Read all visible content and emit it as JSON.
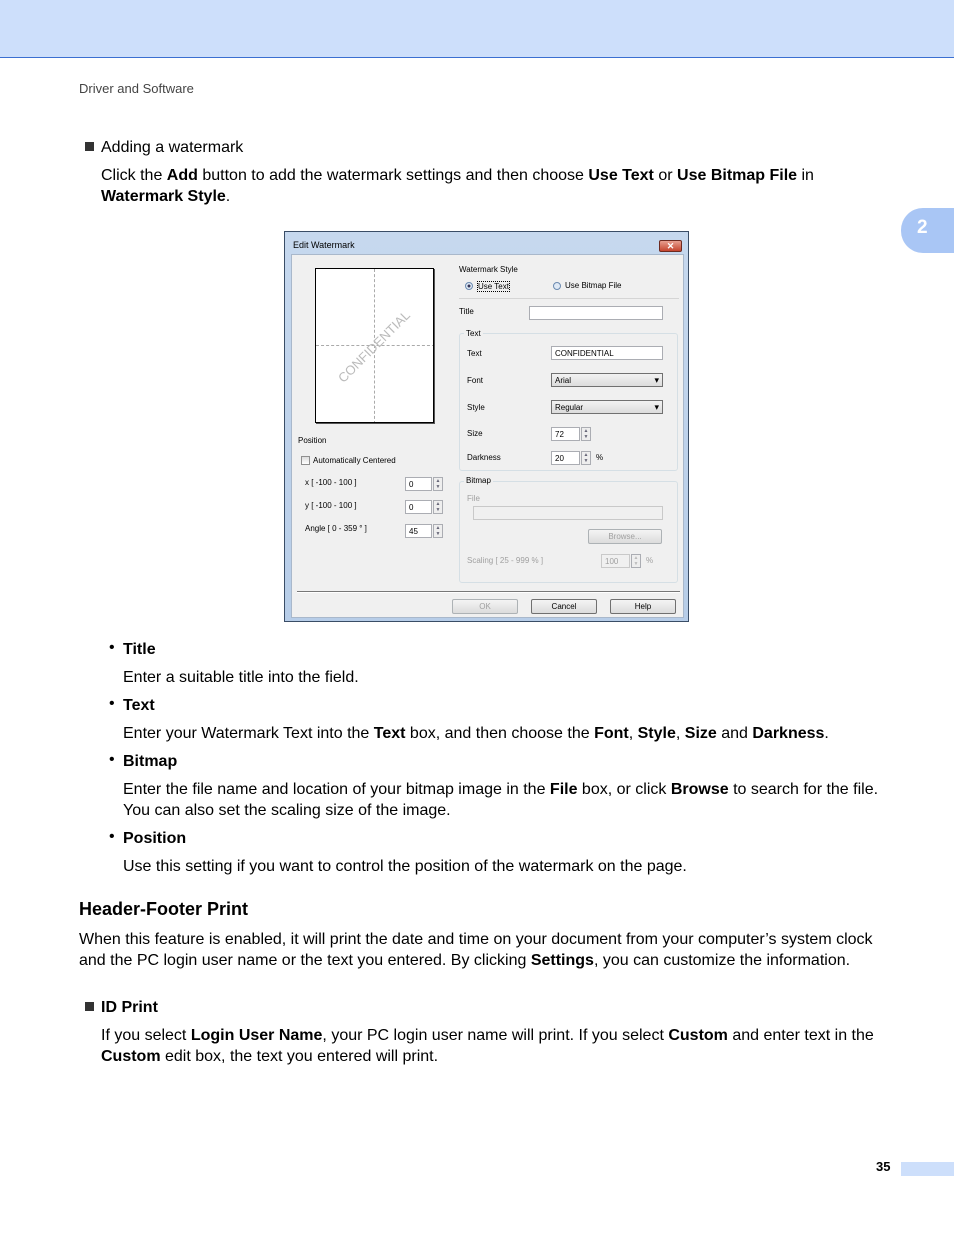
{
  "header": {
    "running_title": "Driver and Software",
    "chapter_tab": "2"
  },
  "intro": {
    "bullet": "Adding a watermark",
    "para": [
      {
        "t": "Click the "
      },
      {
        "b": "Add"
      },
      {
        "t": " button to add the watermark settings and then choose "
      },
      {
        "b": "Use Text"
      },
      {
        "t": " or "
      },
      {
        "b": "Use Bitmap File"
      },
      {
        "t": " in "
      },
      {
        "b": "Watermark Style"
      },
      {
        "t": "."
      }
    ]
  },
  "dialog": {
    "title": "Edit Watermark",
    "preview_text": "CONFIDENTIAL",
    "watermark_style": "Watermark Style",
    "use_text": "Use Text",
    "use_bitmap": "Use Bitmap File",
    "selected": "Use Text",
    "title_label": "Title",
    "title_value": "",
    "text_group": "Text",
    "text_label": "Text",
    "text_value": "CONFIDENTIAL",
    "font_label": "Font",
    "font_value": "Arial",
    "style_label": "Style",
    "style_value": "Regular",
    "size_label": "Size",
    "size_value": "72",
    "darkness_label": "Darkness",
    "darkness_value": "20",
    "percent": "%",
    "bitmap_group": "Bitmap",
    "file_label": "File",
    "file_value": "",
    "browse": "Browse...",
    "scaling_label": "Scaling [ 25 - 999 % ]",
    "scaling_value": "100",
    "position_label": "Position",
    "auto_center": "Automatically Centered",
    "auto_center_checked": false,
    "x_label": "x [ -100  -  100 ]",
    "x_value": "0",
    "y_label": "y [ -100  -  100 ]",
    "y_value": "0",
    "angle_label": "Angle [ 0 - 359 ° ]",
    "angle_value": "45",
    "ok": "OK",
    "cancel": "Cancel",
    "help": "Help"
  },
  "items": [
    {
      "head": "Title",
      "body": [
        {
          "t": "Enter a suitable title into the field."
        }
      ]
    },
    {
      "head": "Text",
      "body": [
        {
          "t": "Enter your Watermark Text into the "
        },
        {
          "b": "Text"
        },
        {
          "t": " box, and then choose the "
        },
        {
          "b": "Font"
        },
        {
          "t": ", "
        },
        {
          "b": "Style"
        },
        {
          "t": ", "
        },
        {
          "b": "Size"
        },
        {
          "t": " and "
        },
        {
          "b": "Darkness"
        },
        {
          "t": "."
        }
      ]
    },
    {
      "head": "Bitmap",
      "body": [
        {
          "t": "Enter the file name and location of your bitmap image in the "
        },
        {
          "b": "File"
        },
        {
          "t": " box, or click "
        },
        {
          "b": "Browse"
        },
        {
          "t": " to search for the file. You can also set the scaling size of the image."
        }
      ]
    },
    {
      "head": "Position",
      "body": [
        {
          "t": "Use this setting if you want to control the position of the watermark on the page."
        }
      ]
    }
  ],
  "section": {
    "heading": "Header-Footer Print",
    "para": [
      {
        "t": "When this feature is enabled, it will print the date and time on your document from your computer’s system clock and the PC login user name or the text you entered. By clicking "
      },
      {
        "b": "Settings"
      },
      {
        "t": ", you can customize the information."
      }
    ],
    "bullet": "ID Print",
    "bullet_para": [
      {
        "t": "If you select "
      },
      {
        "b": "Login User Name"
      },
      {
        "t": ", your PC login user name will print. If you select "
      },
      {
        "b": "Custom"
      },
      {
        "t": " and enter text in the "
      },
      {
        "b": "Custom"
      },
      {
        "t": " edit box, the text you entered will print."
      }
    ]
  },
  "footer": {
    "page_number": "35"
  }
}
